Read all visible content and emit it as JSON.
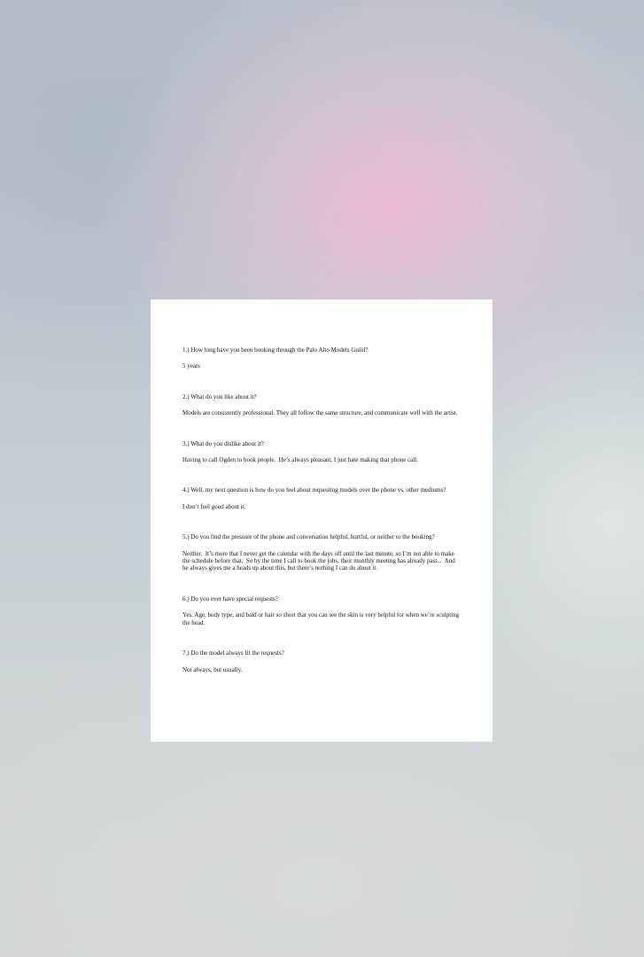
{
  "document": {
    "items": [
      {
        "question": "1.) How long have you been booking through the Palo Alto Models Guild?",
        "answer": "5 years"
      },
      {
        "question": "2.) What do you like about it?",
        "answer": "Models are consistently professional. They all follow the same structure, and communicate well with the artist."
      },
      {
        "question": "3.) What do you dislike about it?",
        "answer": "Having to call Ogden to book people.  He’s always pleasant, I just hate making that phone call."
      },
      {
        "question": "4.) Well, my next question is how do you feel about requesting models over the phone vs. other mediums?",
        "answer": "I don’t feel good about it."
      },
      {
        "question": "5.) Do you find the pressure of the phone and conversation helpful, hurtful, or neither to the booking?",
        "answer": "Neither.  It’s more that I never get the calendar with the days off until the last minute, so I’m not able to make the schedule before that.  So by the time I call to book the jobs, their monthly meeting has already past...  And he always gives me a heads up about this, but there’s nothing I can do about it."
      },
      {
        "question": "6.) Do you ever have special requests?",
        "answer": "Yes. Age, body type, and bald or hair so short that you can see the skin is very helpful for when we’re sculpting the head."
      },
      {
        "question": "7.) Do the model always fit the requests?",
        "answer": "Not always, but usually."
      }
    ]
  }
}
